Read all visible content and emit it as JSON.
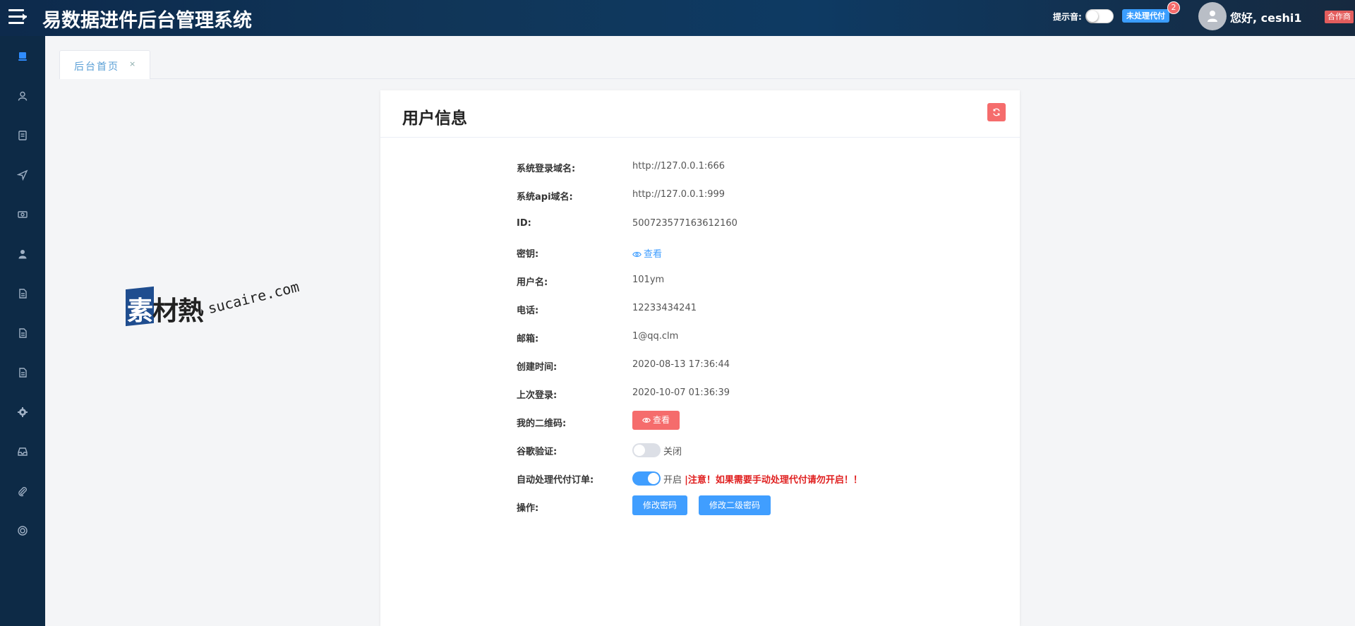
{
  "header": {
    "title": "易数据进件后台管理系统",
    "sound_label": "提示音:",
    "pending_label": "未处理代付",
    "pending_count": "2",
    "greeting": "您好, ceshi1",
    "role": "合作商"
  },
  "sidebar": {
    "items": [
      {
        "icon": "monitor-icon"
      },
      {
        "icon": "user-icon"
      },
      {
        "icon": "document-icon"
      },
      {
        "icon": "send-icon"
      },
      {
        "icon": "money-icon"
      },
      {
        "icon": "person-icon"
      },
      {
        "icon": "file-icon"
      },
      {
        "icon": "file-text-icon"
      },
      {
        "icon": "file-list-icon"
      },
      {
        "icon": "settings-icon"
      },
      {
        "icon": "inbox-icon"
      },
      {
        "icon": "paperclip-icon"
      },
      {
        "icon": "lifebuoy-icon"
      }
    ]
  },
  "tabs": [
    {
      "label": "后台首页",
      "close": "×"
    }
  ],
  "card": {
    "title": "用户信息",
    "rows": {
      "login_domain": {
        "label": "系统登录域名:",
        "value": "http://127.0.0.1:666"
      },
      "api_domain": {
        "label": "系统api域名:",
        "value": "http://127.0.0.1:999"
      },
      "id": {
        "label": "ID:",
        "value": "500723577163612160"
      },
      "secret": {
        "label": "密钥:",
        "value": "查看"
      },
      "username": {
        "label": "用户名:",
        "value": "101ym"
      },
      "phone": {
        "label": "电话:",
        "value": "12233434241"
      },
      "email": {
        "label": "邮箱:",
        "value": "1@qq.clm"
      },
      "created": {
        "label": "创建时间:",
        "value": "2020-08-13 17:36:44"
      },
      "last_login": {
        "label": "上次登录:",
        "value": "2020-10-07 01:36:39"
      },
      "qrcode": {
        "label": "我的二维码:",
        "value": "查看"
      },
      "google_auth": {
        "label": "谷歌验证:",
        "state": "关闭"
      },
      "auto_pay": {
        "label": "自动处理代付订单:",
        "state": "开启",
        "warning": "|注意！如果需要手动处理代付请勿开启！！"
      },
      "actions": {
        "label": "操作:",
        "change_password": "修改密码",
        "change_secondary_password": "修改二级密码"
      }
    }
  },
  "watermark": {
    "cn_first": "素",
    "cn_rest": "材熱",
    "en": "sucaire.com"
  },
  "colors": {
    "header_bg": "#0d2a4c",
    "sidebar_bg": "#0d2a46",
    "primary": "#409eff",
    "danger": "#f56c6c",
    "warning_text": "#e02020"
  }
}
